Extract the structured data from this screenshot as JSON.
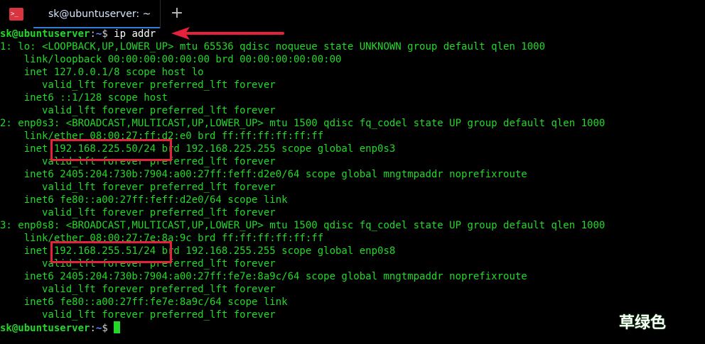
{
  "window": {
    "tab_title": "sk@ubuntuserver: ~",
    "new_tab_glyph": "+",
    "app_icon_glyph": ">_"
  },
  "colors": {
    "terminal_bg": "#000000",
    "text_green": "#23d82a",
    "prompt_path_blue": "#5b8bff",
    "highlight_red": "#e5213c",
    "tab_underline": "#2f7fd6"
  },
  "prompt": {
    "user_host": "sk@ubuntuserver",
    "separator": ":",
    "path": "~",
    "symbol": "$ "
  },
  "command": "ip addr",
  "output": [
    "1: lo: <LOOPBACK,UP,LOWER_UP> mtu 65536 qdisc noqueue state UNKNOWN group default qlen 1000",
    "    link/loopback 00:00:00:00:00:00 brd 00:00:00:00:00:00",
    "    inet 127.0.0.1/8 scope host lo",
    "       valid_lft forever preferred_lft forever",
    "    inet6 ::1/128 scope host",
    "       valid_lft forever preferred_lft forever",
    "2: enp0s3: <BROADCAST,MULTICAST,UP,LOWER_UP> mtu 1500 qdisc fq_codel state UP group default qlen 1000",
    "    link/ether 08:00:27:ff:d2:e0 brd ff:ff:ff:ff:ff:ff",
    "    inet 192.168.225.50/24 brd 192.168.225.255 scope global enp0s3",
    "       valid_lft forever preferred_lft forever",
    "    inet6 2405:204:730b:7904:a00:27ff:feff:d2e0/64 scope global mngtmpaddr noprefixroute",
    "       valid_lft forever preferred_lft forever",
    "    inet6 fe80::a00:27ff:feff:d2e0/64 scope link",
    "       valid_lft forever preferred_lft forever",
    "3: enp0s8: <BROADCAST,MULTICAST,UP,LOWER_UP> mtu 1500 qdisc fq_codel state UP group default qlen 1000",
    "    link/ether 08:00:27:7e:8a:9c brd ff:ff:ff:ff:ff:ff",
    "    inet 192.168.255.51/24 brd 192.168.255.255 scope global enp0s8",
    "       valid_lft forever preferred_lft forever",
    "    inet6 2405:204:730b:7904:a00:27ff:fe7e:8a9c/64 scope global mngtmpaddr noprefixroute",
    "       valid_lft forever preferred_lft forever",
    "    inet6 fe80::a00:27ff:fe7e:8a9c/64 scope link",
    "       valid_lft forever preferred_lft forever"
  ],
  "watermark": "草绿色"
}
